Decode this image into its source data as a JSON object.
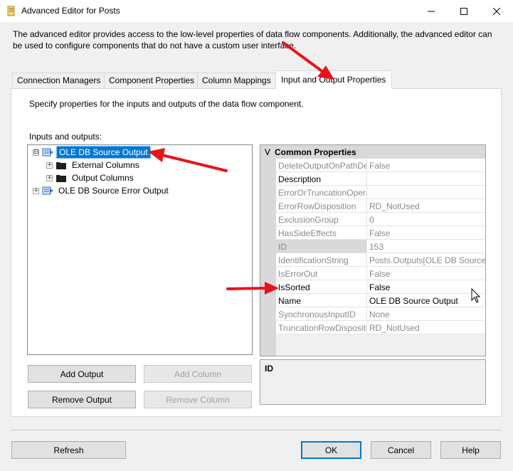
{
  "window": {
    "title": "Advanced Editor for Posts",
    "minimize_icon": "minimize-icon",
    "maximize_icon": "maximize-icon",
    "close_icon": "close-icon"
  },
  "description": "The advanced editor provides access to the low-level properties of data flow components. Additionally, the advanced editor can be used to configure components that do not have a custom user interface.",
  "tabs": [
    {
      "label": "Connection Managers",
      "active": false
    },
    {
      "label": "Component Properties",
      "active": false
    },
    {
      "label": "Column Mappings",
      "active": false
    },
    {
      "label": "Input and Output Properties",
      "active": true
    }
  ],
  "panel": {
    "instructions": "Specify properties for the inputs and outputs of the data flow component.",
    "tree_label": "Inputs and outputs:"
  },
  "tree": {
    "items": [
      {
        "label": "OLE DB Source Output",
        "expander": "⊟",
        "selected": true
      },
      {
        "label": "External Columns",
        "expander": "+"
      },
      {
        "label": "Output Columns",
        "expander": "+"
      },
      {
        "label": "OLE DB Source Error Output",
        "expander": "+"
      }
    ]
  },
  "grid": {
    "category": "Common Properties",
    "collapse_glyph": "⋁",
    "rows": [
      {
        "name": "DeleteOutputOnPathDe",
        "value": "False",
        "readonly": true
      },
      {
        "name": "Description",
        "value": "",
        "readonly": false
      },
      {
        "name": "ErrorOrTruncationOpera",
        "value": "",
        "readonly": true
      },
      {
        "name": "ErrorRowDisposition",
        "value": "RD_NotUsed",
        "readonly": true
      },
      {
        "name": "ExclusionGroup",
        "value": "0",
        "readonly": true
      },
      {
        "name": "HasSideEffects",
        "value": "False",
        "readonly": true
      },
      {
        "name": "ID",
        "value": "153",
        "readonly": true
      },
      {
        "name": "IdentificationString",
        "value": "Posts.Outputs[OLE DB Source O",
        "readonly": true
      },
      {
        "name": "IsErrorOut",
        "value": "False",
        "readonly": true
      },
      {
        "name": "IsSorted",
        "value": "False",
        "readonly": false
      },
      {
        "name": "Name",
        "value": "OLE DB Source Output",
        "readonly": false
      },
      {
        "name": "SynchronousInputID",
        "value": "None",
        "readonly": true
      },
      {
        "name": "TruncationRowDispositi",
        "value": "RD_NotUsed",
        "readonly": true
      }
    ]
  },
  "help": {
    "title": "ID"
  },
  "buttons": {
    "add_output": "Add Output",
    "add_column": "Add Column",
    "remove_output": "Remove Output",
    "remove_column": "Remove Column",
    "refresh": "Refresh",
    "ok": "OK",
    "cancel": "Cancel",
    "help": "Help"
  },
  "colors": {
    "selection": "#0078d7",
    "annotation_arrow": "#e8141b"
  }
}
